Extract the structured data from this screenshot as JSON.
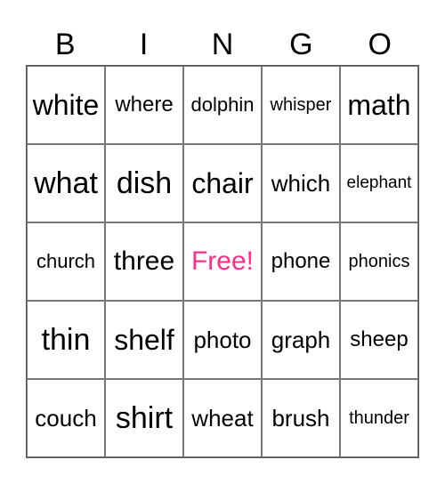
{
  "header": [
    "B",
    "I",
    "N",
    "G",
    "O"
  ],
  "free_color": "#ff2d87",
  "cells": [
    [
      "white",
      "where",
      "dolphin",
      "whisper",
      "math"
    ],
    [
      "what",
      "dish",
      "chair",
      "which",
      "elephant"
    ],
    [
      "church",
      "three",
      "Free!",
      "phone",
      "phonics"
    ],
    [
      "thin",
      "shelf",
      "photo",
      "graph",
      "sheep"
    ],
    [
      "couch",
      "shirt",
      "wheat",
      "brush",
      "thunder"
    ]
  ]
}
